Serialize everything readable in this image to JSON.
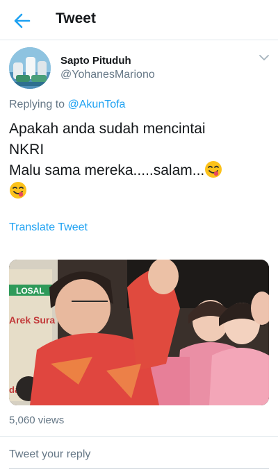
{
  "header": {
    "title": "Tweet",
    "back_icon": "arrow-left-icon"
  },
  "author": {
    "name": "Sapto Pituduh",
    "handle": "@YohanesMariono"
  },
  "reply": {
    "prefix": "Replying to ",
    "mention": "@AkunTofa"
  },
  "tweet": {
    "line1": "Apakah anda sudah mencintai",
    "line2": "NKRI",
    "line3": "Malu sama mereka.....salam...",
    "emoji": "face-savoring-food-emoji"
  },
  "translate_label": "Translate Tweet",
  "media": {
    "banner_text_1": "LOSAL",
    "banner_text_2": "Arek Sura",
    "banner_text_3": "da Ta"
  },
  "views_label": "5,060 views",
  "reply_placeholder": "Tweet your reply",
  "colors": {
    "accent": "#1da1f2",
    "secondary_text": "#657786",
    "primary_text": "#14171a"
  }
}
